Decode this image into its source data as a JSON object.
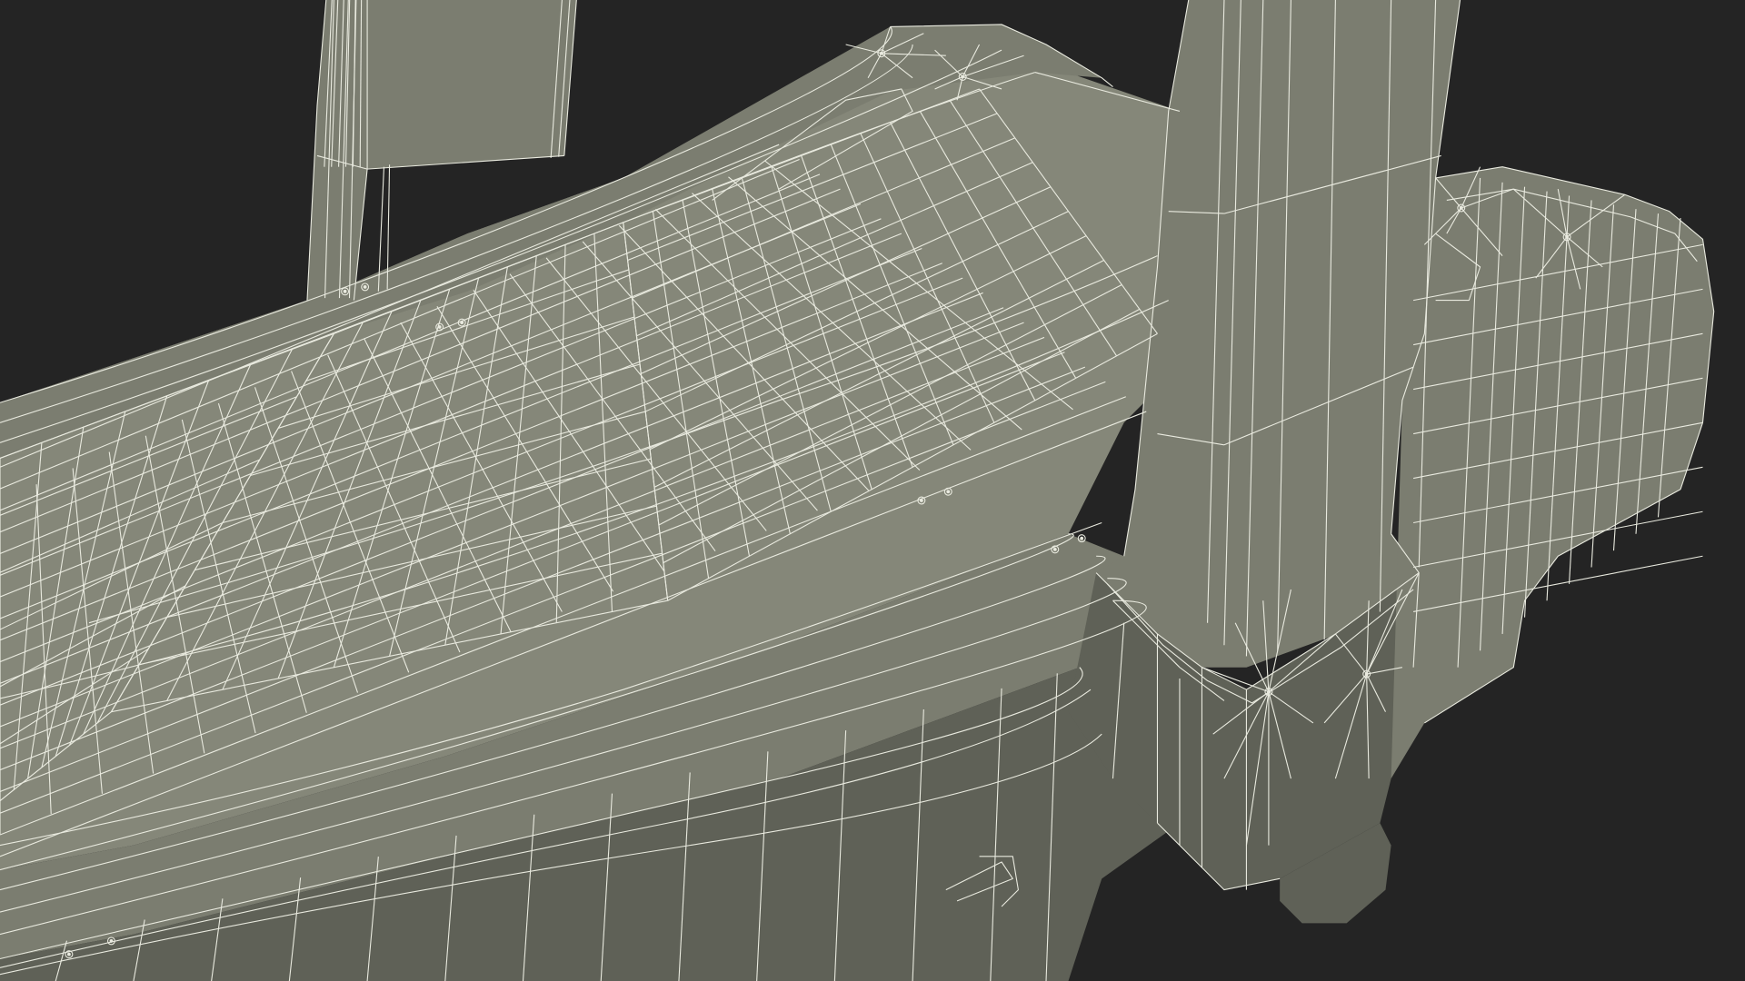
{
  "scene": {
    "subject": "treadmill-wireframe-render",
    "colors": {
      "background": "#242424",
      "surface": "#7b7d70",
      "surface_light": "#858779",
      "surface_dark": "#5f6157",
      "wire": "#e9eadf"
    }
  }
}
